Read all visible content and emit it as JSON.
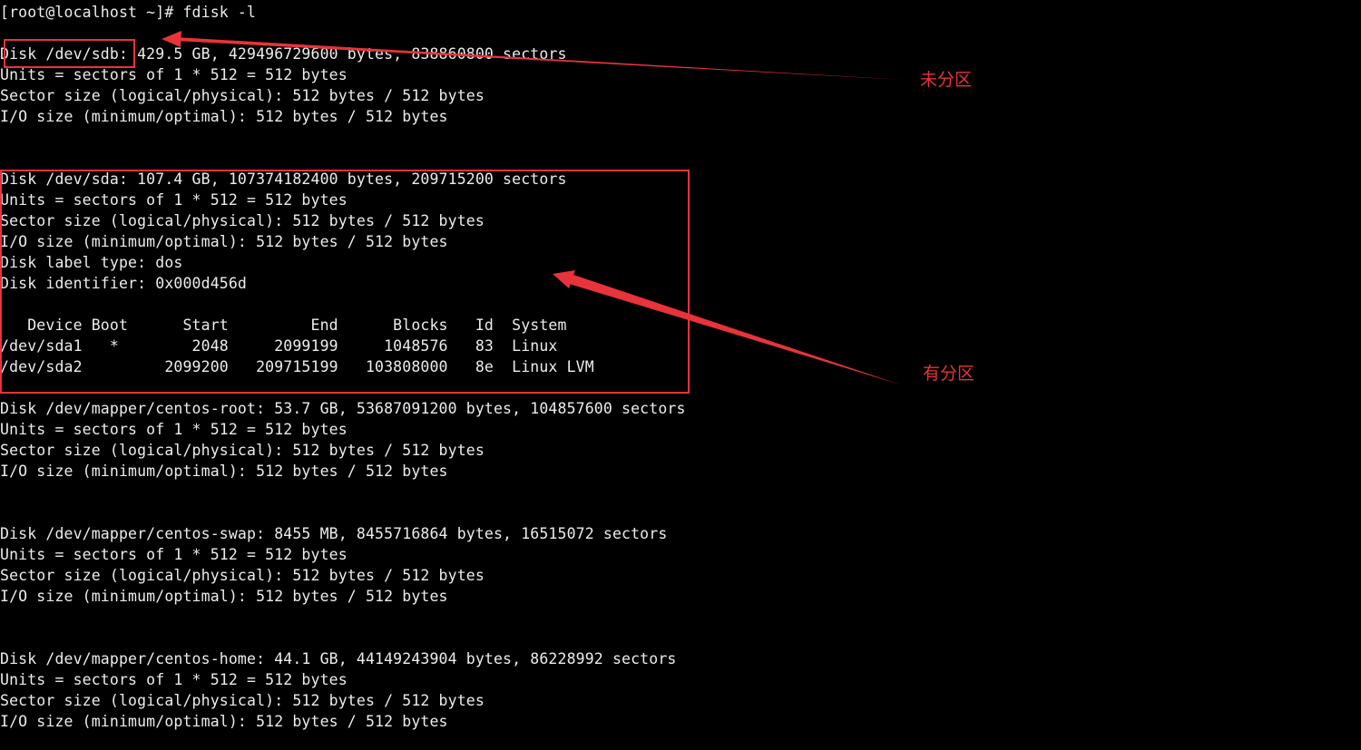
{
  "terminal": {
    "lines": [
      "[root@localhost ~]# fdisk -l",
      "",
      "Disk /dev/sdb: 429.5 GB, 429496729600 bytes, 838860800 sectors",
      "Units = sectors of 1 * 512 = 512 bytes",
      "Sector size (logical/physical): 512 bytes / 512 bytes",
      "I/O size (minimum/optimal): 512 bytes / 512 bytes",
      "",
      "",
      "Disk /dev/sda: 107.4 GB, 107374182400 bytes, 209715200 sectors",
      "Units = sectors of 1 * 512 = 512 bytes",
      "Sector size (logical/physical): 512 bytes / 512 bytes",
      "I/O size (minimum/optimal): 512 bytes / 512 bytes",
      "Disk label type: dos",
      "Disk identifier: 0x000d456d",
      "",
      "   Device Boot      Start         End      Blocks   Id  System",
      "/dev/sda1   *        2048     2099199     1048576   83  Linux",
      "/dev/sda2         2099200   209715199   103808000   8e  Linux LVM",
      "",
      "Disk /dev/mapper/centos-root: 53.7 GB, 53687091200 bytes, 104857600 sectors",
      "Units = sectors of 1 * 512 = 512 bytes",
      "Sector size (logical/physical): 512 bytes / 512 bytes",
      "I/O size (minimum/optimal): 512 bytes / 512 bytes",
      "",
      "",
      "Disk /dev/mapper/centos-swap: 8455 MB, 8455716864 bytes, 16515072 sectors",
      "Units = sectors of 1 * 512 = 512 bytes",
      "Sector size (logical/physical): 512 bytes / 512 bytes",
      "I/O size (minimum/optimal): 512 bytes / 512 bytes",
      "",
      "",
      "Disk /dev/mapper/centos-home: 44.1 GB, 44149243904 bytes, 86228992 sectors",
      "Units = sectors of 1 * 512 = 512 bytes",
      "Sector size (logical/physical): 512 bytes / 512 bytes",
      "I/O size (minimum/optimal): 512 bytes / 512 bytes"
    ]
  },
  "annotations": {
    "unpartitioned_label": "未分区",
    "partitioned_label": "有分区",
    "color": "#e8333a"
  },
  "colors": {
    "background": "#000000",
    "text": "#ececec",
    "annotation": "#e8333a"
  }
}
